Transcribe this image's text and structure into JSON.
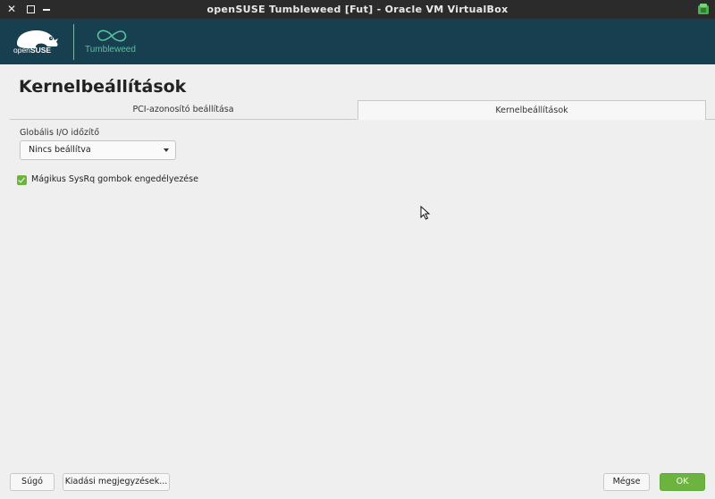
{
  "window": {
    "title": "openSUSE Tumbleweed [Fut] - Oracle VM VirtualBox",
    "close_glyph": "✕",
    "controls": [
      "close-icon",
      "maximize-icon",
      "minimize-icon",
      "virtualbox-icon"
    ]
  },
  "header": {
    "brand_open": "open",
    "brand_suse": "SUSE",
    "product": "Tumbleweed",
    "colors": {
      "background": "#173f4f",
      "accent": "#58c19e"
    }
  },
  "page": {
    "title": "Kernelbeállítások"
  },
  "tabs": [
    {
      "label": "PCI-azonosító beállítása",
      "active": false
    },
    {
      "label": "Kernelbeállítások",
      "active": true
    }
  ],
  "form": {
    "io_scheduler": {
      "label": "Globális I/O időzítő",
      "value": "Nincs beállítva"
    },
    "sysrq": {
      "label": "Mágikus SysRq gombok engedélyezése",
      "checked": true
    }
  },
  "buttons": {
    "help": "Súgó",
    "release_notes": "Kiadási megjegyzések...",
    "cancel": "Mégse",
    "ok": "OK"
  },
  "colors": {
    "primary_green": "#6db33f",
    "titlebar": "#2b2b2b"
  }
}
